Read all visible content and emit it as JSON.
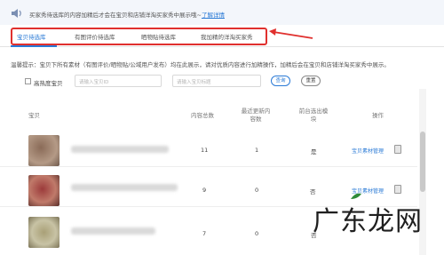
{
  "notice": {
    "icon": "speaker-icon",
    "text": "买家秀待选库的内容加精后才会在宝贝和店铺洋淘买家秀中展示哦~",
    "link": "了解详情"
  },
  "tabs": [
    {
      "label": "宝贝待选库",
      "active": true
    },
    {
      "label": "有图评价待选库",
      "active": false
    },
    {
      "label": "晒物贴待选库",
      "active": false
    },
    {
      "label": "我加精的洋淘买家秀",
      "active": false
    }
  ],
  "hint": "温馨提示：宝贝下所有素材（有图评价/晒物贴/公域用户发布）均在此展示，请对优质内容进行加精操作，加精后会在宝贝和店铺洋淘买家秀中展示。",
  "filter": {
    "checkbox_label": "高热度宝贝",
    "input1_placeholder": "请输入宝贝ID",
    "input2_placeholder": "请输入宝贝标题",
    "search_label": "查询",
    "reset_label": "重置"
  },
  "table": {
    "headers": {
      "item": "宝贝",
      "total": "内容总数",
      "recent_line1": "最近更新内",
      "recent_line2": "容数",
      "selected_line1": "前台选出模",
      "selected_line2": "块",
      "ops": "操作"
    },
    "rows": [
      {
        "total": "11",
        "recent": "1",
        "selected": "是",
        "op": "宝贝素材管理"
      },
      {
        "total": "9",
        "recent": "0",
        "selected": "否",
        "op": "宝贝素材管理"
      },
      {
        "total": "7",
        "recent": "0",
        "selected": "否",
        "op": ""
      }
    ]
  },
  "watermark": "广东龙网",
  "colors": {
    "accent": "#2a7ad6",
    "highlight_box": "#e0302e",
    "notice_bg": "#f3f6fb"
  }
}
